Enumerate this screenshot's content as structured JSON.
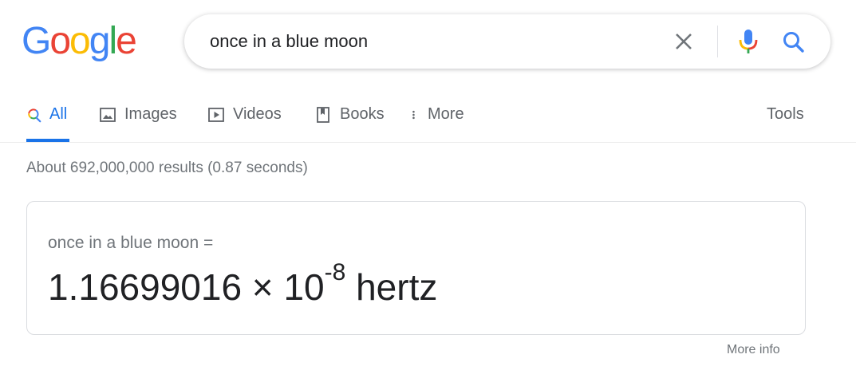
{
  "logo": {
    "letters": [
      "G",
      "o",
      "o",
      "g",
      "l",
      "e"
    ],
    "colors": [
      "#4285F4",
      "#EA4335",
      "#FBBC05",
      "#4285F4",
      "#34A853",
      "#EA4335"
    ]
  },
  "search": {
    "query": "once in a blue moon",
    "clear_icon": "close-icon",
    "mic_icon": "microphone-icon",
    "search_icon": "search-icon"
  },
  "tabs": [
    {
      "label": "All",
      "icon": "search-icon",
      "active": true
    },
    {
      "label": "Images",
      "icon": "image-icon",
      "active": false
    },
    {
      "label": "Videos",
      "icon": "play-icon",
      "active": false
    },
    {
      "label": "Books",
      "icon": "book-icon",
      "active": false
    },
    {
      "label": "More",
      "icon": "more-vert-icon",
      "active": false
    }
  ],
  "tools_label": "Tools",
  "result_stats": "About 692,000,000 results (0.87 seconds)",
  "answer": {
    "query_line": "once in a blue moon =",
    "mantissa": "1.16699016 × 10",
    "exponent": "-8",
    "unit": "hertz"
  },
  "more_info_label": "More info",
  "colors": {
    "accent": "#1a73e8",
    "text_secondary": "#5f6368",
    "text_muted": "#70757a"
  }
}
